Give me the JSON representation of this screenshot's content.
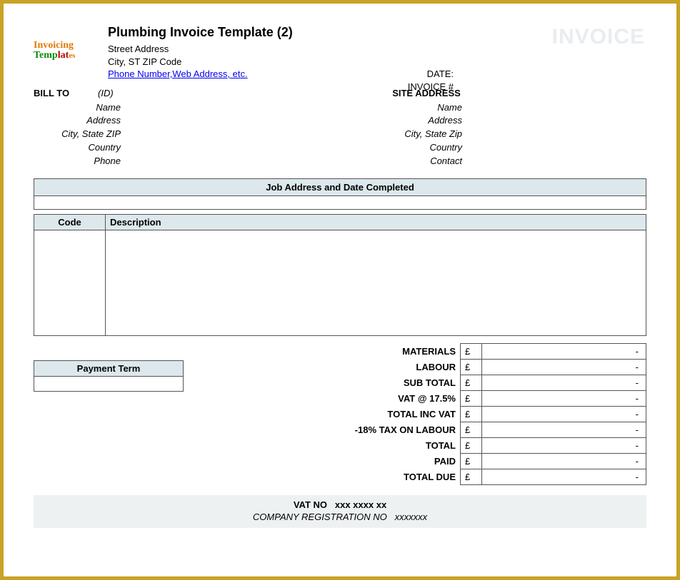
{
  "header": {
    "logo_text_1": "Invoicing",
    "logo_text_2": "Templates",
    "title": "Plumbing Invoice Template (2)",
    "street": "Street Address",
    "city": "City, ST  ZIP Code",
    "contact_link": "Phone Number,Web Address, etc.",
    "watermark": "INVOICE",
    "date_label": "DATE:",
    "invoice_num_label": "INVOICE #"
  },
  "billto": {
    "heading": "BILL TO",
    "id_label": "(ID)",
    "fields": {
      "name": "Name",
      "address": "Address",
      "csz": "City, State ZIP",
      "country": "Country",
      "phone": "Phone"
    }
  },
  "site": {
    "heading": "SITE ADDRESS",
    "fields": {
      "name": "Name",
      "address": "Address",
      "csz": "City, State Zip",
      "country": "Country",
      "contact": "Contact"
    }
  },
  "job_band": "Job Address and Date Completed",
  "items": {
    "code_header": "Code",
    "desc_header": "Description"
  },
  "payment_term": "Payment Term",
  "totals": {
    "currency": "£",
    "dash": "-",
    "rows": {
      "materials": "MATERIALS",
      "labour": "LABOUR",
      "subtotal": "SUB TOTAL",
      "vat": "VAT @ 17.5%",
      "total_inc_vat": "TOTAL INC VAT",
      "tax_on_labour": "-18% TAX ON LABOUR",
      "total": "TOTAL",
      "paid": "PAID",
      "total_due": "TOTAL DUE"
    }
  },
  "footer": {
    "vat_label": "VAT NO",
    "vat_value": "xxx xxxx xx",
    "reg_label": "COMPANY REGISTRATION NO",
    "reg_value": "xxxxxxx"
  }
}
